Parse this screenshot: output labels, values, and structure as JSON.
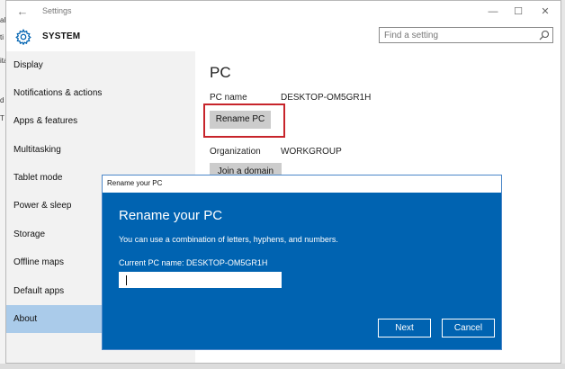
{
  "window": {
    "app_title": "Settings",
    "back_icon": "arrow-left-icon",
    "controls": {
      "minimize": "—",
      "maximize": "☐",
      "close": "✕"
    }
  },
  "header": {
    "icon": "gear-icon",
    "section": "SYSTEM",
    "search_placeholder": "Find a setting"
  },
  "sidebar": {
    "items": [
      {
        "label": "Display"
      },
      {
        "label": "Notifications & actions"
      },
      {
        "label": "Apps & features"
      },
      {
        "label": "Multitasking"
      },
      {
        "label": "Tablet mode"
      },
      {
        "label": "Power & sleep"
      },
      {
        "label": "Storage"
      },
      {
        "label": "Offline maps"
      },
      {
        "label": "Default apps"
      },
      {
        "label": "About"
      }
    ],
    "selected": "About"
  },
  "main": {
    "title": "PC",
    "pc_name_label": "PC name",
    "pc_name_value": "DESKTOP-OM5GR1H",
    "rename_button": "Rename PC",
    "organization_label": "Organization",
    "organization_value": "WORKGROUP",
    "join_button": "Join a domain"
  },
  "dialog": {
    "window_title": "Rename your PC",
    "heading": "Rename your PC",
    "description": "You can use a combination of letters, hyphens, and numbers.",
    "current_name": "Current PC name: DESKTOP-OM5GR1H",
    "input_value": "",
    "next_button": "Next",
    "cancel_button": "Cancel"
  },
  "colors": {
    "accent": "#0063b1",
    "selected_nav": "#aacbea",
    "highlight_box": "#c7242b"
  }
}
